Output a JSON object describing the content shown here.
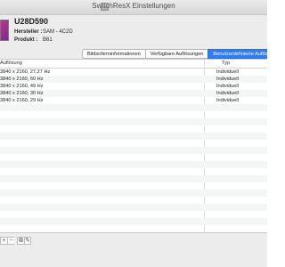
{
  "window": {
    "title": "SwitchResX Einstellungen"
  },
  "display": {
    "name": "U28D590",
    "manufacturer_label": "Hersteller :",
    "manufacturer": "SAM - 4C2D",
    "product_label": "Produkt :",
    "product": "B61"
  },
  "tabs": [
    {
      "label": "Bildschirminformationen",
      "active": false
    },
    {
      "label": "Verfügbare Auflösungen",
      "active": false
    },
    {
      "label": "Benutzerdefinierte Auflösungen",
      "active": true
    }
  ],
  "table": {
    "columns": {
      "resolution": "Auflösung",
      "type": "Typ"
    },
    "rows": [
      {
        "resolution": "3840 x 2160, 27,27 Hz",
        "type": "Individuell"
      },
      {
        "resolution": "3840 x 2160, 60 Hz",
        "type": "Individuell"
      },
      {
        "resolution": "3840 x 2160, 49 Hz",
        "type": "Individuell"
      },
      {
        "resolution": "3840 x 2160, 30 Hz",
        "type": "Individuell"
      },
      {
        "resolution": "3840 x 2160, 29 Hz",
        "type": "Individuell"
      }
    ]
  },
  "toolbar": {
    "add": "+",
    "remove": "−",
    "duplicate": "⧉",
    "edit": "✎"
  }
}
